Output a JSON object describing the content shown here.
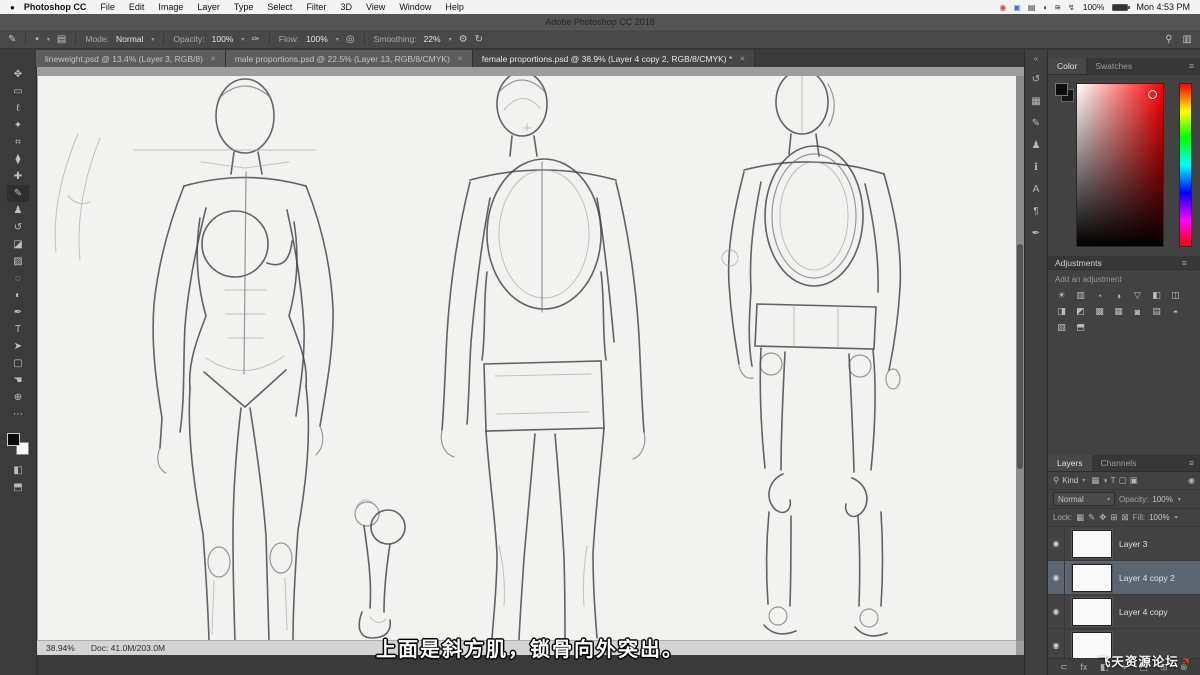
{
  "chrome": {
    "window_title": "Adobe Photoshop CC 2018",
    "close_icon": "✕",
    "caret": "▾",
    "menu_icon": "≡",
    "collapse_icon": "«",
    "eye_icon": "◉"
  },
  "menu_bar": {
    "apple_icon": "●",
    "app_name": "Photoshop CC",
    "items": [
      "File",
      "Edit",
      "Image",
      "Layer",
      "Type",
      "Select",
      "Filter",
      "3D",
      "View",
      "Window",
      "Help"
    ],
    "status_icons": [
      {
        "name": "screen-record-icon",
        "glyph": "◉"
      },
      {
        "name": "blue-app-icon",
        "glyph": "▣"
      },
      {
        "name": "display-icon",
        "glyph": "▤"
      },
      {
        "name": "volume-icon",
        "glyph": "◖"
      },
      {
        "name": "wifi-icon",
        "glyph": "≋"
      },
      {
        "name": "power-icon",
        "glyph": "↯"
      }
    ],
    "battery": "100%",
    "clock": "Mon 4:53 PM"
  },
  "options_bar": {
    "brush_tool_icon": "✎",
    "brush_tip_icon": "•",
    "panel_toggle_icon": "▤",
    "mode_label": "Mode:",
    "mode_value": "Normal",
    "opacity_label": "Opacity:",
    "opacity_value": "100%",
    "pressure_icon": "✑",
    "flow_label": "Flow:",
    "flow_value": "100%",
    "airbrush_icon": "◎",
    "smoothing_label": "Smoothing:",
    "smoothing_value": "22%",
    "gear_icon": "⚙",
    "rotate_icon": "↻",
    "search_icon": "⚲",
    "workspace_icon": "▥"
  },
  "tabs": [
    {
      "label": "lineweight.psd @ 13.4% (Layer 3, RGB/8)",
      "active": false
    },
    {
      "label": "male proportions.psd @ 22.5% (Layer 13, RGB/8/CMYK)",
      "active": false
    },
    {
      "label": "female proportions.psd @ 38.9% (Layer 4 copy 2, RGB/8/CMYK) *",
      "active": true
    }
  ],
  "toolbar": {
    "tools": [
      {
        "name": "move-tool-icon",
        "glyph": "✥"
      },
      {
        "name": "marquee-tool-icon",
        "glyph": "▭"
      },
      {
        "name": "lasso-tool-icon",
        "glyph": "ℓ"
      },
      {
        "name": "quick-selection-tool-icon",
        "glyph": "✦"
      },
      {
        "name": "crop-tool-icon",
        "glyph": "⌗"
      },
      {
        "name": "eyedropper-tool-icon",
        "glyph": "⧫"
      },
      {
        "name": "healing-brush-tool-icon",
        "glyph": "✚"
      },
      {
        "name": "brush-tool-icon",
        "glyph": "✎"
      },
      {
        "name": "clone-stamp-tool-icon",
        "glyph": "♟"
      },
      {
        "name": "history-brush-tool-icon",
        "glyph": "↺"
      },
      {
        "name": "eraser-tool-icon",
        "glyph": "◪"
      },
      {
        "name": "gradient-tool-icon",
        "glyph": "▨"
      },
      {
        "name": "blur-tool-icon",
        "glyph": "◌"
      },
      {
        "name": "dodge-tool-icon",
        "glyph": "◐"
      },
      {
        "name": "pen-tool-icon",
        "glyph": "✒"
      },
      {
        "name": "type-tool-icon",
        "glyph": "T"
      },
      {
        "name": "path-selection-tool-icon",
        "glyph": "➤"
      },
      {
        "name": "shape-tool-icon",
        "glyph": "▢"
      },
      {
        "name": "hand-tool-icon",
        "glyph": "☚"
      },
      {
        "name": "zoom-tool-icon",
        "glyph": "⊕"
      },
      {
        "name": "edit-toolbar-icon",
        "glyph": "⋯"
      }
    ],
    "quick_mask_icon": "◧",
    "screen_mode_icon": "⬒"
  },
  "dock": {
    "icons": [
      {
        "name": "history-panel-icon",
        "glyph": "↺"
      },
      {
        "name": "swatches-panel-icon",
        "glyph": "▦"
      },
      {
        "name": "brush-settings-panel-icon",
        "glyph": "✎"
      },
      {
        "name": "clone-source-panel-icon",
        "glyph": "♟"
      },
      {
        "name": "info-panel-icon",
        "glyph": "ℹ"
      },
      {
        "name": "character-panel-icon",
        "glyph": "A"
      },
      {
        "name": "paragraph-panel-icon",
        "glyph": "¶"
      },
      {
        "name": "pen-presets-panel-icon",
        "glyph": "✒"
      }
    ]
  },
  "panels": {
    "color": {
      "tabs": [
        "Color",
        "Swatches"
      ],
      "picker_hue": "#ff0000"
    },
    "adjustments": {
      "title": "Adjustments",
      "subtitle": "Add an adjustment",
      "icons": [
        {
          "name": "brightness-contrast-icon",
          "glyph": "☀"
        },
        {
          "name": "levels-icon",
          "glyph": "▥"
        },
        {
          "name": "curves-icon",
          "glyph": "◔"
        },
        {
          "name": "exposure-icon",
          "glyph": "◑"
        },
        {
          "name": "vibrance-icon",
          "glyph": "▽"
        },
        {
          "name": "hue-saturation-icon",
          "glyph": "◧"
        },
        {
          "name": "color-balance-icon",
          "glyph": "◫"
        },
        {
          "name": "black-white-icon",
          "glyph": "◨"
        },
        {
          "name": "photo-filter-icon",
          "glyph": "◩"
        },
        {
          "name": "channel-mixer-icon",
          "glyph": "▩"
        },
        {
          "name": "color-lookup-icon",
          "glyph": "▦"
        },
        {
          "name": "invert-icon",
          "glyph": "◙"
        },
        {
          "name": "posterize-icon",
          "glyph": "▤"
        },
        {
          "name": "threshold-icon",
          "glyph": "◓"
        },
        {
          "name": "selective-color-icon",
          "glyph": "▧"
        },
        {
          "name": "gradient-map-icon",
          "glyph": "⬒"
        }
      ]
    },
    "layers": {
      "tabs": [
        "Layers",
        "Channels"
      ],
      "filter_icon": "⚲",
      "kind_label": "Kind",
      "filter_icons": [
        {
          "name": "filter-pixel-layers-icon",
          "glyph": "▦"
        },
        {
          "name": "filter-adjustment-layers-icon",
          "glyph": "◑"
        },
        {
          "name": "filter-type-layers-icon",
          "glyph": "T"
        },
        {
          "name": "filter-shape-layers-icon",
          "glyph": "▢"
        },
        {
          "name": "filter-smart-objects-icon",
          "glyph": "▣"
        }
      ],
      "blend_mode": "Normal",
      "opacity_label": "Opacity:",
      "opacity_value": "100%",
      "lock_label": "Lock:",
      "lock_icons": [
        {
          "name": "lock-transparent-pixels-icon",
          "glyph": "▦"
        },
        {
          "name": "lock-image-pixels-icon",
          "glyph": "✎"
        },
        {
          "name": "lock-position-icon",
          "glyph": "✥"
        },
        {
          "name": "lock-artboard-icon",
          "glyph": "⊞"
        },
        {
          "name": "lock-all-icon",
          "glyph": "⊠"
        }
      ],
      "fill_label": "Fill:",
      "fill_value": "100%",
      "items": [
        {
          "name": "Layer 3",
          "selected": false
        },
        {
          "name": "Layer 4 copy 2",
          "selected": true
        },
        {
          "name": "Layer 4 copy",
          "selected": false
        },
        {
          "name": "",
          "selected": false
        }
      ],
      "bottom_icons": [
        {
          "name": "link-layers-icon",
          "glyph": "⊂"
        },
        {
          "name": "layer-effects-icon",
          "glyph": "fx"
        },
        {
          "name": "layer-mask-icon",
          "glyph": "◧"
        },
        {
          "name": "adjustment-layer-icon",
          "glyph": "◑"
        },
        {
          "name": "layer-group-icon",
          "glyph": "▢"
        },
        {
          "name": "new-layer-icon",
          "glyph": "⊞"
        },
        {
          "name": "delete-layer-icon",
          "glyph": "⊗"
        }
      ]
    }
  },
  "status_bar": {
    "zoom": "38.94%",
    "doc": "Doc: 41.0M/203.0M"
  },
  "subtitle": {
    "text": "上面是斜方肌，锁骨向外突出。"
  },
  "watermark": {
    "text": "飞天资源论坛",
    "icon": "✈"
  }
}
